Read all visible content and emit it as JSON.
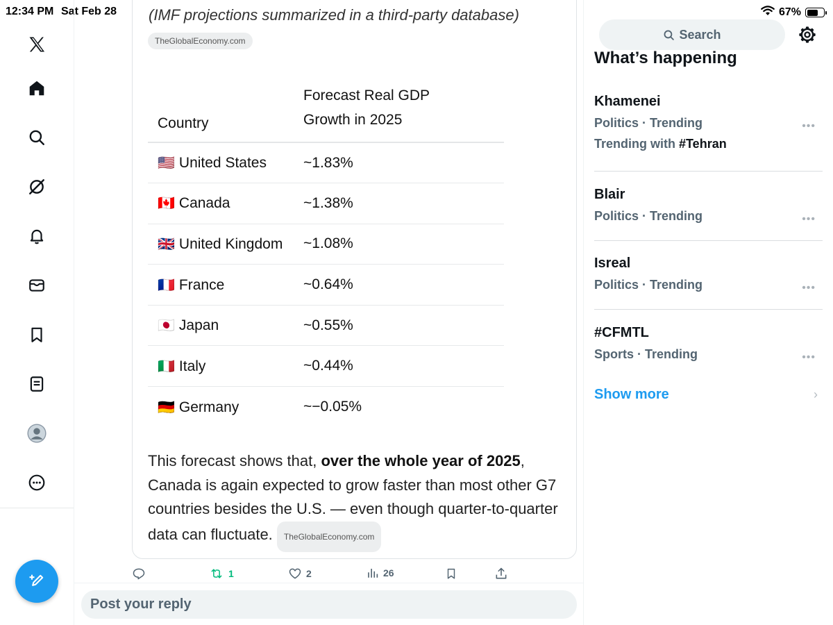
{
  "status_bar": {
    "time": "12:34 PM",
    "date": "Sat Feb 28",
    "battery_pct": "67%",
    "battery_level": 0.67
  },
  "nav": {
    "items": [
      "logo",
      "home",
      "explore",
      "grok",
      "notifications",
      "messages",
      "bookmarks",
      "lists",
      "profile",
      "more"
    ]
  },
  "post": {
    "caption": "(IMF projections summarized in a third-party database)",
    "source_pill": "TheGlobalEconomy.com",
    "table": {
      "header_country": "Country",
      "header_growth_line1": "Forecast Real GDP",
      "header_growth_line2": "Growth in 2025",
      "rows": [
        {
          "flag": "🇺🇸",
          "country": "United States",
          "growth": "~1.83%"
        },
        {
          "flag": "🇨🇦",
          "country": "Canada",
          "growth": "~1.38%"
        },
        {
          "flag": "🇬🇧",
          "country": "United Kingdom",
          "growth": "~1.08%"
        },
        {
          "flag": "🇫🇷",
          "country": "France",
          "growth": "~0.64%"
        },
        {
          "flag": "🇯🇵",
          "country": "Japan",
          "growth": "~0.55%"
        },
        {
          "flag": "🇮🇹",
          "country": "Italy",
          "growth": "~0.44%"
        },
        {
          "flag": "🇩🇪",
          "country": "Germany",
          "growth": "~−0.05%"
        }
      ]
    },
    "body_intro": "This forecast shows that, ",
    "body_bold": "over the whole year of 2025",
    "body_rest": ", Canada is again expected to grow faster than most other G7 countries besides the U.S. — even though quarter-to-quarter data can fluctuate.",
    "body_pill": "TheGlobalEconomy.com"
  },
  "actions": {
    "retweets": "1",
    "likes": "2",
    "views": "26"
  },
  "reply_placeholder": "Post your reply",
  "sidebar": {
    "search_label": "Search",
    "whats_happening": "What’s happening",
    "trends": [
      {
        "title": "Khamenei",
        "meta": "Politics · Trending",
        "with_label": "Trending with",
        "with_tag": "#Tehran"
      },
      {
        "title": "Blair",
        "meta": "Politics · Trending"
      },
      {
        "title": "Isreal",
        "meta": "Politics · Trending"
      },
      {
        "title": "#CFMTL",
        "meta": "Sports · Trending"
      }
    ],
    "show_more": "Show more"
  }
}
